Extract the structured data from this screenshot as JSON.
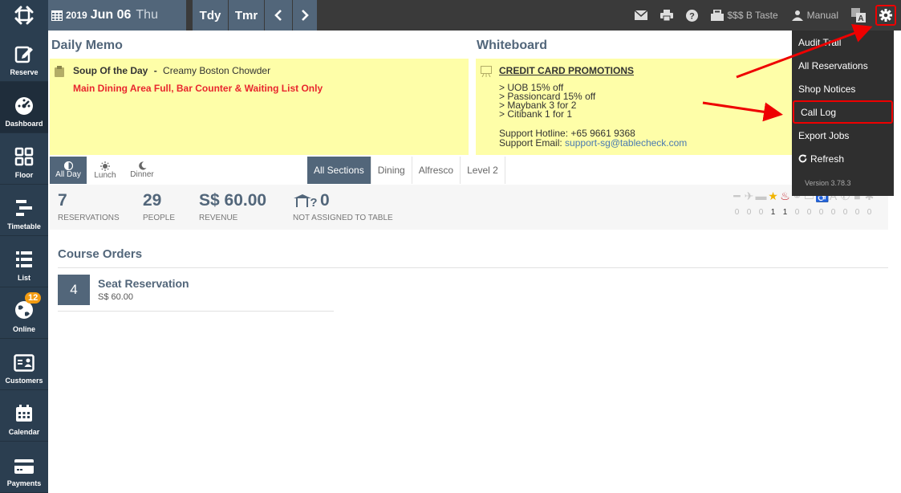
{
  "topbar": {
    "date": {
      "year": "2019",
      "month_day": "Jun 06",
      "weekday": "Thu"
    },
    "nav": {
      "today": "Tdy",
      "tomorrow": "Tmr"
    },
    "shop_name": "$$$ B Taste",
    "manual_label": "Manual"
  },
  "sidebar": {
    "items": [
      {
        "label": "Reserve"
      },
      {
        "label": "Dashboard"
      },
      {
        "label": "Floor"
      },
      {
        "label": "Timetable"
      },
      {
        "label": "List"
      },
      {
        "label": "Online",
        "badge": "12"
      },
      {
        "label": "Customers"
      },
      {
        "label": "Calendar"
      },
      {
        "label": "Payments"
      }
    ]
  },
  "memo": {
    "title": "Daily Memo",
    "soup_label": "Soup Of the Day",
    "soup_sep": "-",
    "soup_value": "Creamy Boston Chowder",
    "alert": "Main Dining Area Full, Bar Counter & Waiting List Only"
  },
  "whiteboard": {
    "title": "Whiteboard",
    "heading": "CREDIT CARD PROMOTIONS",
    "lines": [
      "> UOB 15% off",
      "> Passioncard 15% off",
      "> Maybank 3 for 2",
      "> Citibank 1 for 1"
    ],
    "hotline": "Support Hotline: +65 9661 9368",
    "email_label": "Support Email:",
    "email": "support-sg@tablecheck.com"
  },
  "services": [
    {
      "label": "All Day"
    },
    {
      "label": "Lunch"
    },
    {
      "label": "Dinner"
    }
  ],
  "sections": [
    "All Sections",
    "Dining",
    "Alfresco",
    "Level 2"
  ],
  "stats": {
    "reservations": {
      "value": "7",
      "label": "RESERVATIONS"
    },
    "people": {
      "value": "29",
      "label": "PEOPLE"
    },
    "revenue": {
      "value": "S$ 60.00",
      "label": "REVENUE"
    },
    "unassigned": {
      "value": "0",
      "label": "NOT ASSIGNED TO TABLE"
    }
  },
  "tag_counts": [
    "0",
    "0",
    "0",
    "1",
    "1",
    "0",
    "0",
    "0",
    "0",
    "0",
    "0",
    "0"
  ],
  "course_orders": {
    "title": "Course Orders",
    "items": [
      {
        "count": "4",
        "name": "Seat Reservation",
        "price": "S$ 60.00"
      }
    ]
  },
  "menu": {
    "items": [
      "Audit Trail",
      "All Reservations",
      "Shop Notices",
      "Call Log",
      "Export Jobs",
      "Refresh"
    ],
    "version": "Version 3.78.3"
  },
  "colors": {
    "sidebar": "#2b3e50",
    "accent": "#52667a",
    "topbar": "#3a3a3a",
    "memo_bg": "#fefea8",
    "alert": "#e8262e",
    "highlight": "#e00000"
  }
}
